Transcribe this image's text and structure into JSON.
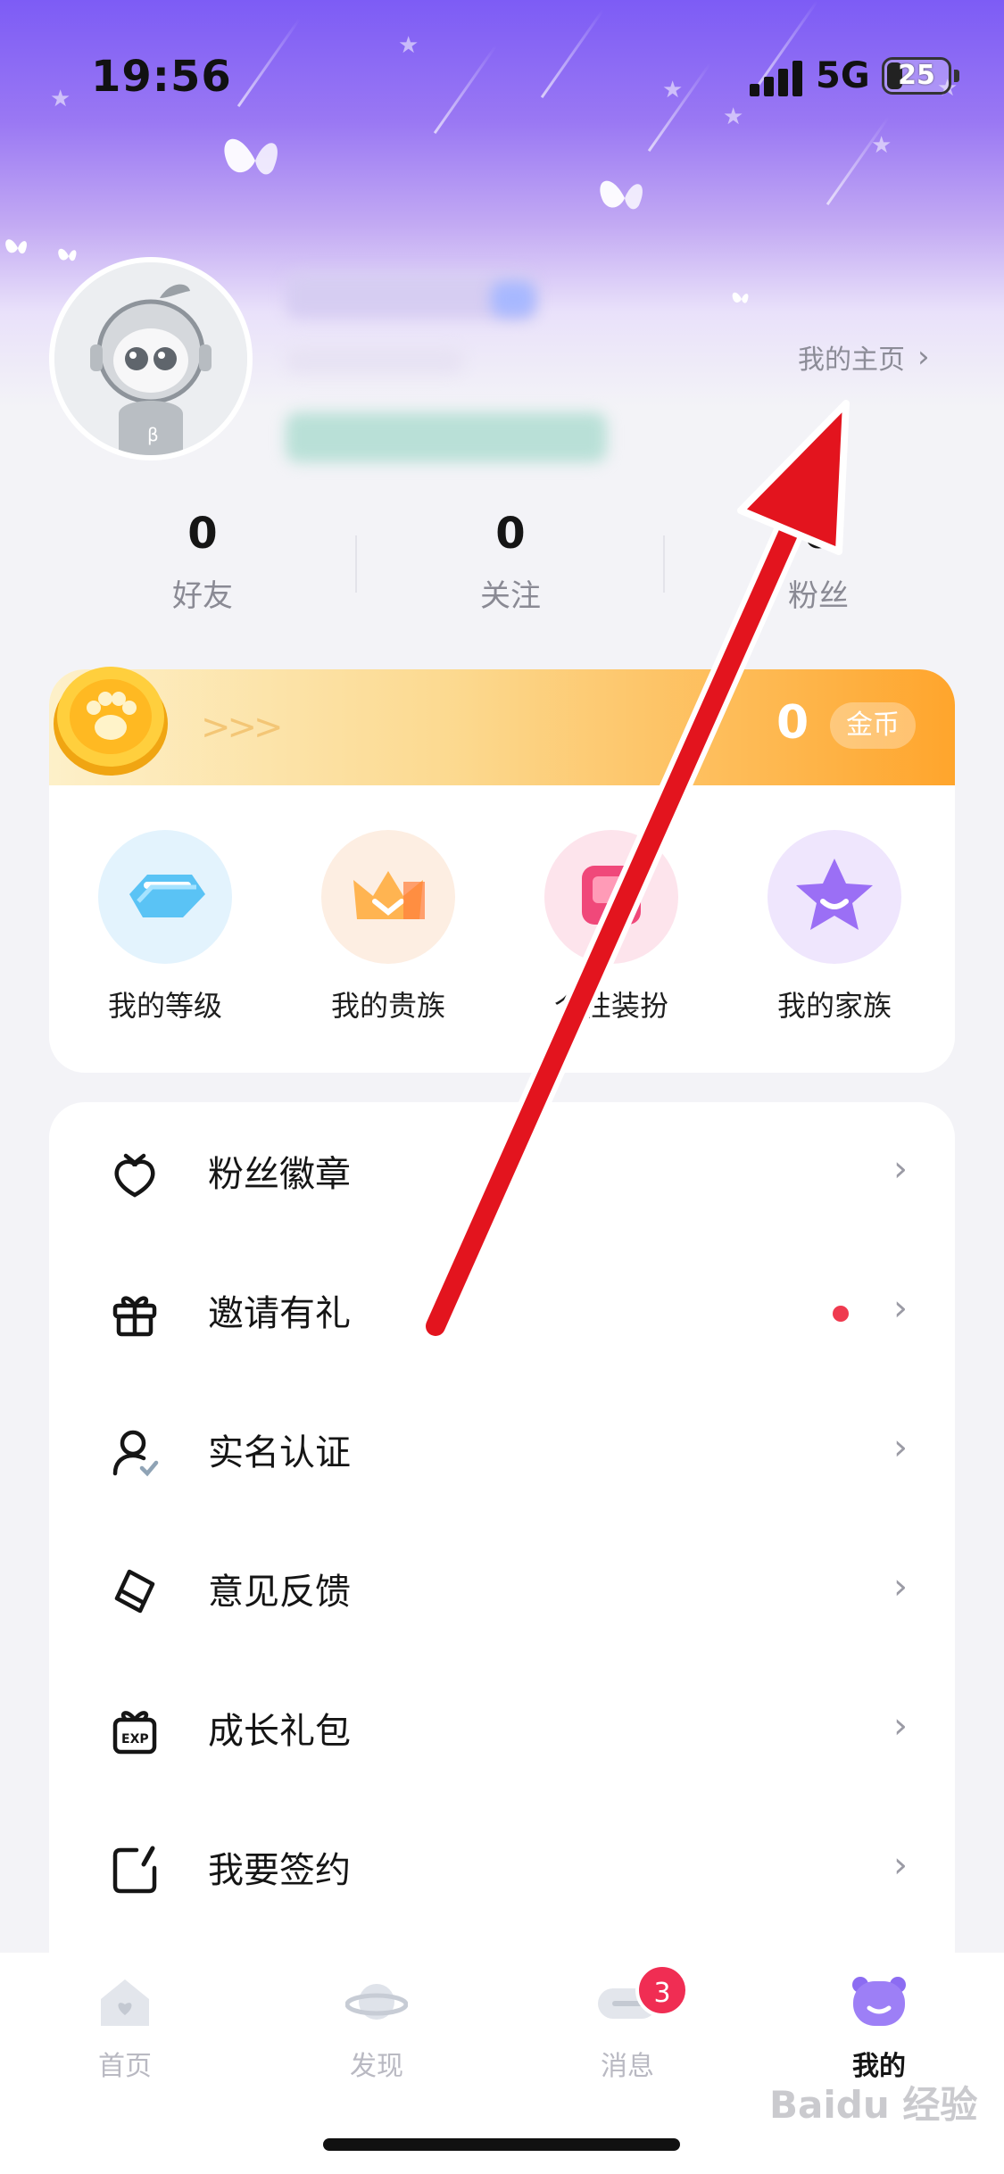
{
  "status_bar": {
    "time": "19:56",
    "network": "5G",
    "battery": "25"
  },
  "profile": {
    "homepage_link": "我的主页"
  },
  "stats": [
    {
      "value": "0",
      "label": "好友"
    },
    {
      "value": "0",
      "label": "关注"
    },
    {
      "value": "0",
      "label": "粉丝"
    }
  ],
  "coins": {
    "arrows": ">>>",
    "value": "0",
    "unit": "金币"
  },
  "features": [
    {
      "label": "我的等级",
      "icon": "diamond-tag-icon",
      "color": "#5ac3f5"
    },
    {
      "label": "我的贵族",
      "icon": "crown-icon",
      "color": "#ff9a3c"
    },
    {
      "label": "个性装扮",
      "icon": "dressup-icon",
      "color": "#f0487a"
    },
    {
      "label": "我的家族",
      "icon": "star-face-icon",
      "color": "#9b6ff5"
    }
  ],
  "menu": [
    {
      "label": "粉丝徽章",
      "icon": "strawberry-badge-icon",
      "dot": false
    },
    {
      "label": "邀请有礼",
      "icon": "gift-icon",
      "dot": true
    },
    {
      "label": "实名认证",
      "icon": "verified-user-icon",
      "dot": false
    },
    {
      "label": "意见反馈",
      "icon": "feedback-tag-icon",
      "dot": false
    },
    {
      "label": "成长礼包",
      "icon": "exp-gift-icon",
      "dot": false
    },
    {
      "label": "我要签约",
      "icon": "sign-edit-icon",
      "dot": false
    }
  ],
  "tabs": [
    {
      "label": "首页",
      "icon": "home-icon",
      "active": false
    },
    {
      "label": "发现",
      "icon": "planet-icon",
      "active": false
    },
    {
      "label": "消息",
      "icon": "message-icon",
      "active": false,
      "badge": "3"
    },
    {
      "label": "我的",
      "icon": "profile-bear-icon",
      "active": true
    }
  ],
  "watermark": "Baidu 经验",
  "colors": {
    "accent": "#7d5cf5",
    "coin": "#ffa52c",
    "arrow": "#e3141e",
    "badge": "#f02d53"
  }
}
